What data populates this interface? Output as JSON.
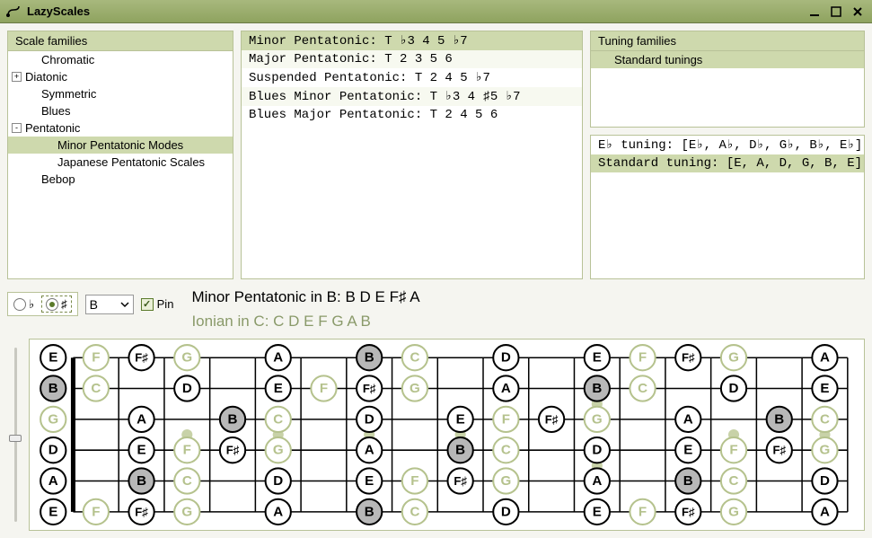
{
  "window": {
    "title": "LazyScales"
  },
  "scale_families": {
    "header": "Scale families",
    "items": [
      {
        "label": "Chromatic",
        "indent": 1,
        "exp": null
      },
      {
        "label": "Diatonic",
        "indent": 0,
        "exp": "+"
      },
      {
        "label": "Symmetric",
        "indent": 1,
        "exp": null
      },
      {
        "label": "Blues",
        "indent": 1,
        "exp": null
      },
      {
        "label": "Pentatonic",
        "indent": 0,
        "exp": "-"
      },
      {
        "label": "Minor Pentatonic Modes",
        "indent": 2,
        "exp": null,
        "selected": true
      },
      {
        "label": "Japanese Pentatonic Scales",
        "indent": 2,
        "exp": null
      },
      {
        "label": "Bebop",
        "indent": 1,
        "exp": null
      }
    ]
  },
  "scale_list": [
    {
      "label": "Minor Pentatonic: T ♭3 4 5 ♭7",
      "selected": true
    },
    {
      "label": "Major Pentatonic: T 2 3 5 6"
    },
    {
      "label": "Suspended Pentatonic: T 2 4 5 ♭7"
    },
    {
      "label": "Blues Minor Pentatonic: T ♭3 4 ♯5 ♭7"
    },
    {
      "label": "Blues Major Pentatonic: T 2 4 5 6"
    }
  ],
  "tuning_families": {
    "header": "Tuning families",
    "items": [
      {
        "label": "Standard tunings",
        "indent": 1,
        "selected": true
      }
    ]
  },
  "tunings": [
    {
      "label": "E♭ tuning: [E♭, A♭, D♭, G♭, B♭, E♭]"
    },
    {
      "label": "Standard tuning: [E, A, D, G, B, E]",
      "selected": true
    }
  ],
  "controls": {
    "flat_symbol": "♭",
    "sharp_symbol": "♯",
    "accidental_selected": "sharp",
    "key_selected": "B",
    "pin_label": "Pin",
    "pin_checked": true
  },
  "scale_display": {
    "line1": "Minor Pentatonic in B: B D E F♯ A",
    "line2": "Ionian in C: C D E F G A B"
  },
  "fretboard": {
    "strings": 6,
    "frets_shown": 17,
    "open_notes_top_to_bottom": [
      "E",
      "B",
      "G",
      "D",
      "A",
      "E"
    ],
    "scale_notes": [
      "B",
      "D",
      "E",
      "F♯",
      "A"
    ],
    "root": "B",
    "secondary_scale_notes": [
      "C",
      "D",
      "E",
      "F",
      "G",
      "A",
      "B"
    ],
    "inlay_frets": [
      3,
      5,
      7,
      9,
      12,
      15,
      17
    ],
    "colors": {
      "scale_fill": "#ffffff",
      "scale_stroke": "#000000",
      "root_fill": "#b8b8b8",
      "root_stroke": "#000000",
      "secondary_fill": "#ffffff",
      "secondary_stroke": "#b5c28d",
      "secondary_text": "#b5c28d",
      "inlay": "#c8d2a8"
    }
  }
}
